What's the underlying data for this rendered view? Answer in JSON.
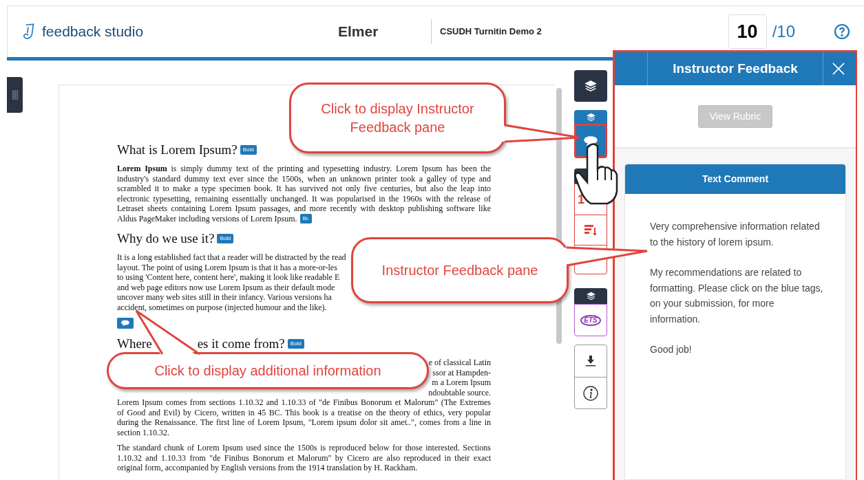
{
  "header": {
    "logo": "feedback studio",
    "student": "Elmer",
    "class_name": "CSUDH Turnitin Demo 2",
    "score": "10",
    "max_score": "/10"
  },
  "document": {
    "sections": [
      {
        "heading": [
          "What is Lorem Ipsum?"
        ],
        "tag": "Bold",
        "paragraphs": [
          {
            "lines": [
              {
                "text": "**Lorem Ipsum** is simply dummy text of the printing and typesetting industry. Lorem Ipsum has been the",
                "kind": "full"
              },
              {
                "text": "industry's standard dummy text ever since the 1500s, when an unknown printer took a galley of type and",
                "kind": "full"
              },
              {
                "text": "scrambled it to make a type specimen book. It has survived not only five centuries, but also the leap into",
                "kind": "full"
              },
              {
                "text": "electronic typesetting, remaining essentially unchanged. It was popularised in the 1960s with the release of",
                "kind": "full"
              },
              {
                "text": "Letraset sheets containing Lorem Ipsum passages, and more recently with desktop publishing software like",
                "kind": "full"
              },
              {
                "text": "Aldus PageMaker including versions of Lorem Ipsum.",
                "kind": "left"
              }
            ],
            "tag": "Br."
          }
        ]
      },
      {
        "heading": [
          "Why do we use it?"
        ],
        "tag": "Bold",
        "paragraphs": [
          {
            "lines": [
              {
                "text": "It is a long established fact that a reader will be distracted by the read",
                "kind": "left"
              },
              {
                "text": "layout. The point of using Lorem Ipsum is that it has a more-or-les",
                "kind": "left"
              },
              {
                "text": "to using 'Content here, content here', making it look like readable E",
                "kind": "left"
              },
              {
                "text": "and web page editors now use Lorem Ipsum as their default mode",
                "kind": "left"
              },
              {
                "text": "uncover many web sites still in their infancy. Various versions ha",
                "kind": "left"
              },
              {
                "text": "accident, sometimes on purpose (injected humour and the like).",
                "kind": "left"
              }
            ],
            "comment": true
          }
        ]
      },
      {
        "heading": [
          "Where",
          "es it come from?"
        ],
        "tag": "Bold",
        "paragraphs": [
          {
            "lines": [
              {
                "text": "e of classical Latin",
                "kind": "right"
              },
              {
                "text": "ssor at Hampden-",
                "kind": "right"
              },
              {
                "text": "m a Lorem Ipsum",
                "kind": "right"
              },
              {
                "text": "ndoubtable source.",
                "kind": "right"
              },
              {
                "text": "Lorem Ipsum comes from sections 1.10.32 and 1.10.33 of \"de Finibus Bonorum et Malorum\" (The Extremes",
                "kind": "full"
              },
              {
                "text": "of Good and Evil) by Cicero, written in 45 BC. This book is a treatise on the theory of ethics, very popular",
                "kind": "full"
              },
              {
                "text": "during the Renaissance. The first line of Lorem Ipsum, \"Lorem ipsum dolor sit amet..\", comes from a line in",
                "kind": "full"
              },
              {
                "text": "section 1.10.32.",
                "kind": "left"
              }
            ]
          },
          {
            "lines": [
              {
                "text": "The standard chunk of Lorem Ipsum used since the 1500s is reproduced below for those interested. Sections",
                "kind": "full"
              },
              {
                "text": "1.10.32 and 1.10.33 from \"de Finibus Bonorum et Malorum\" by Cicero are also reproduced in their exact",
                "kind": "full"
              },
              {
                "text": "original form, accompanied by English versions from the 1914 translation by H. Rackham.",
                "kind": "left"
              }
            ]
          }
        ]
      }
    ]
  },
  "toolbar": {
    "comment_selected": true,
    "similarity": "1",
    "ets": "ETS"
  },
  "panel": {
    "title": "Instructor Feedback",
    "rubric_button": {
      "label": "View Rubric",
      "disabled": true
    },
    "comment": {
      "title": "Text Comment",
      "paragraphs": [
        "Very comprehensive information related to the history of lorem ipsum.",
        "My recommendations are related to formatting. Please click on the blue tags, on your submission, for more information.",
        "Good job!"
      ]
    }
  },
  "callouts": [
    {
      "text": "Click to display Instructor Feedback pane"
    },
    {
      "text": "Instructor Feedback pane"
    },
    {
      "text": "Click to display additional information"
    }
  ]
}
